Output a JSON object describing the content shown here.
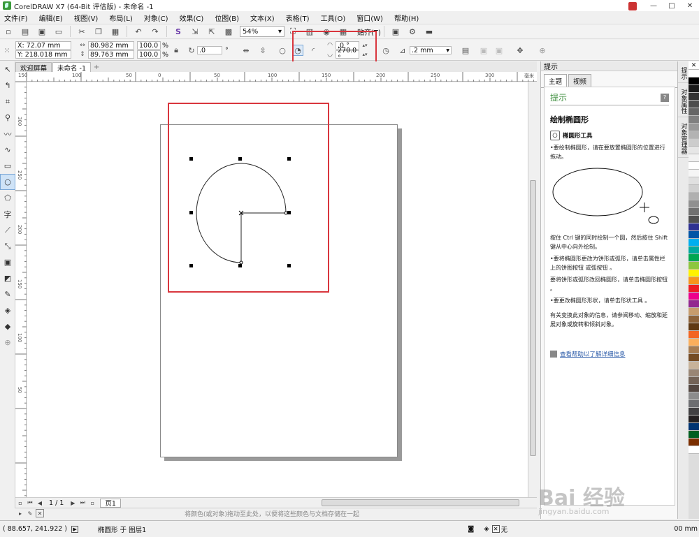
{
  "titlebar": {
    "title": "CorelDRAW X7 (64-Bit 评估版) - 未命名 -1",
    "minimize": "—",
    "maximize": "□",
    "close": "✕"
  },
  "menu": [
    "文件(F)",
    "编辑(E)",
    "视图(V)",
    "布局(L)",
    "对象(C)",
    "效果(C)",
    "位图(B)",
    "文本(X)",
    "表格(T)",
    "工具(O)",
    "窗口(W)",
    "帮助(H)"
  ],
  "toolbar": {
    "zoom": "54%",
    "snap": "贴齐(T)"
  },
  "propbar": {
    "x": "X: 72.07 mm",
    "y": "Y: 218.018 mm",
    "w": "80.982 mm",
    "h": "89.763 mm",
    "sx": "100.0",
    "sy": "100.0",
    "pct": "%",
    "rotation": ".0",
    "degree": "°",
    "start_angle": ".0 °",
    "end_angle": "270.0 °",
    "outline": ".2 mm"
  },
  "doc_tabs": [
    "欢迎屏幕",
    "未命名 -1"
  ],
  "ruler_h": [
    "150",
    "100",
    "50",
    "0",
    "50",
    "100",
    "150",
    "200",
    "250",
    "300"
  ],
  "ruler_v": [
    "300",
    "250",
    "200",
    "150",
    "100",
    "50"
  ],
  "ruler_unit": "毫米",
  "page_nav": {
    "pages": "1 / 1",
    "page_tab": "页1"
  },
  "palette_hint": "将颜色(或对象)拖动至此处，以便将这些颜色与文档存储在一起",
  "status": {
    "coords": "( 88.657, 241.922 )",
    "object": "椭圆形 于 图层1",
    "fill": "无",
    "outline": "00 mm"
  },
  "docker": {
    "header": "提示",
    "tabs": [
      "主题",
      "视频"
    ],
    "title": "提示",
    "help_icon": "?",
    "heading": "绘制椭圆形",
    "tool_name": "椭圆形工具",
    "tip1": "•要绘制椭圆形，请在要放置椭圆形的位置进行拖动。",
    "tip2": "按住 Ctrl 键的同时绘制一个圆，然后按住 Shift 键从中心向外绘制。",
    "tip3": "•要将椭圆形更改为饼形或弧形，请单击属性栏上的饼图按钮 或弧按钮 。",
    "tip4": "要将饼形或弧形改回椭圆形，请单击椭圆形按钮 。",
    "tip5": "•要更改椭圆形形状，请单击形状工具 。",
    "tip6": "有关变换此对象的信息，请参阅移动、缩放和延展对象或旋转和倾斜对象。",
    "link": "查看帮助以了解详细信息"
  },
  "side_tabs": [
    "提示",
    "对象属性",
    "对象管理器"
  ],
  "watermark": {
    "line1": "Bai 经验",
    "line2": "jingyan.baidu.com"
  },
  "colors": {
    "highlight": "#d9363e",
    "accent": "#3f8f3f"
  }
}
